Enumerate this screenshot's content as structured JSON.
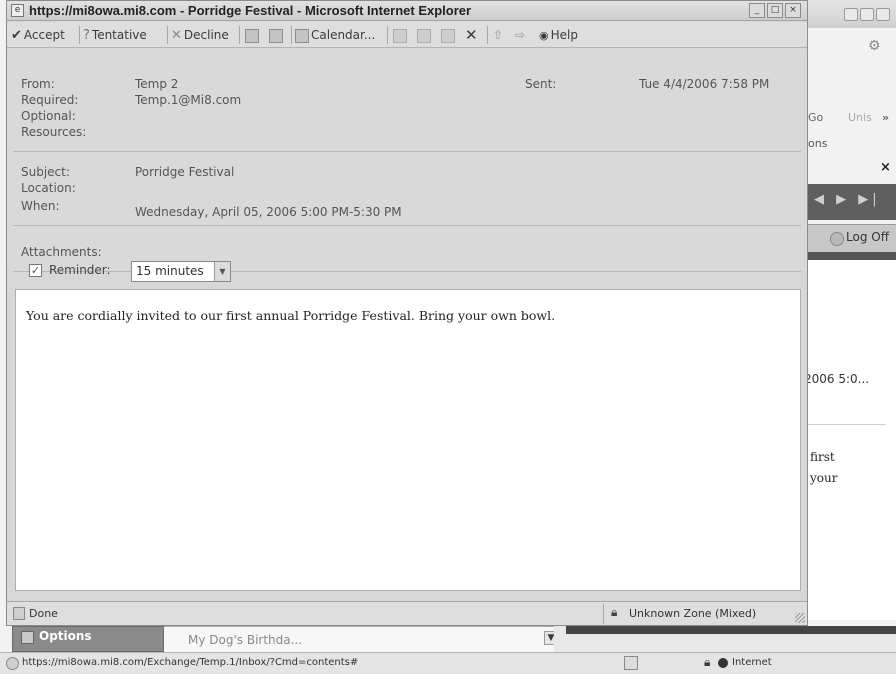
{
  "window": {
    "title": "https://mi8owa.mi8.com - Porridge Festival - Microsoft Internet Explorer",
    "title_icon": "ie-page-icon"
  },
  "toolbar": {
    "accept_label": "Accept",
    "tentative_label": "Tentative",
    "decline_label": "Decline",
    "calendar_label": "Calendar...",
    "help_label": "Help"
  },
  "header": {
    "from_label": "From:",
    "from_value": "Temp 2",
    "sent_label": "Sent:",
    "sent_value": "Tue 4/4/2006 7:58 PM",
    "required_label": "Required:",
    "required_value": "Temp.1@Mi8.com",
    "optional_label": "Optional:",
    "resources_label": "Resources:",
    "subject_label": "Subject:",
    "subject_value": "Porridge Festival",
    "location_label": "Location:",
    "when_label": "When:",
    "when_value": "Wednesday, April 05, 2006 5:00 PM-5:30 PM",
    "attachments_label": "Attachments:"
  },
  "reminder": {
    "label": "Reminder:",
    "checked": true,
    "value": "15 minutes"
  },
  "body": {
    "text": "You are cordially invited to our first annual Porridge Festival. Bring your own bowl."
  },
  "popup_status": {
    "text": "Done",
    "zone": "Unknown Zone (Mixed)"
  },
  "background": {
    "toolbar_go": "Go",
    "toolbar_units": "Unis",
    "toolbar_more": "»",
    "ons_text": "ons",
    "close_x": "×",
    "logoff_label": "Log Off",
    "date_text": "2006 5:0...",
    "body_line1": "first",
    "body_line2": "your",
    "options_label": "Options",
    "select_text": "My Dog's Birthda...",
    "status_url": "https://mi8owa.mi8.com/Exchange/Temp.1/Inbox/?Cmd=contents#",
    "status_zone": "Internet"
  },
  "colors": {
    "window_bg": "#d7d7d7",
    "body_bg": "#ffffff",
    "dark_bar": "#555555"
  }
}
